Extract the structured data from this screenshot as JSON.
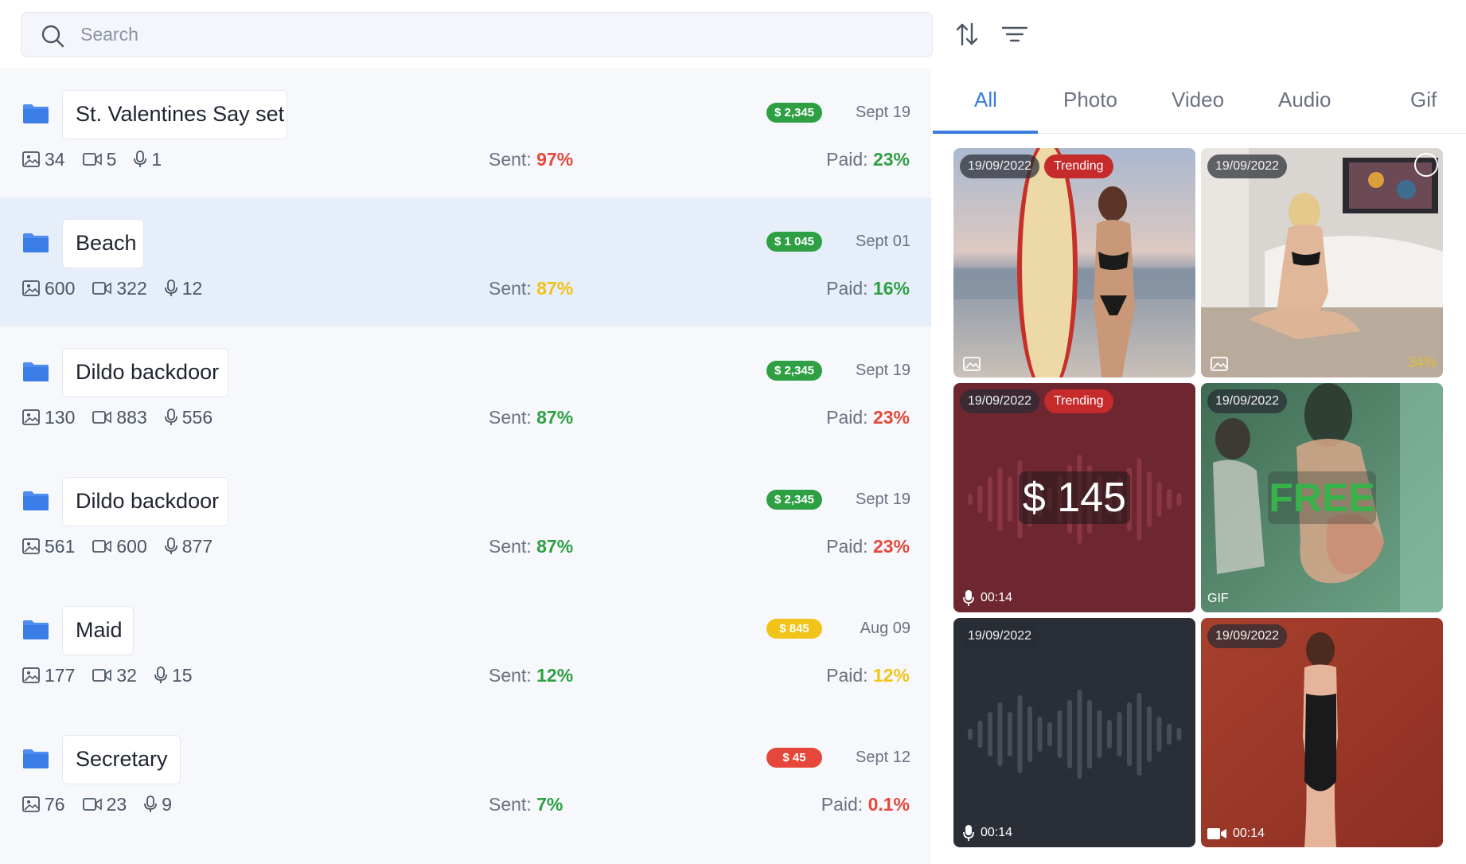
{
  "search": {
    "placeholder": "Search"
  },
  "toolbar": {
    "sort_icon": "sort-arrows-icon",
    "filter_icon": "filter-lines-icon"
  },
  "folders": [
    {
      "name": "St. Valentines Say set",
      "price": "$ 2,345",
      "price_color": "#2ea043",
      "date": "Sept 19",
      "photos": "34",
      "videos": "5",
      "audio": "1",
      "sent_label": "Sent:",
      "sent": "97%",
      "sent_color": "#e5483a",
      "paid_label": "Paid:",
      "paid": "23%",
      "paid_color": "#2ea043"
    },
    {
      "name": "Beach",
      "price": "$ 1 045",
      "price_color": "#2ea043",
      "date": "Sept 01",
      "photos": "600",
      "videos": "322",
      "audio": "12",
      "sent_label": "Sent:",
      "sent": "87%",
      "sent_color": "#f2c318",
      "paid_label": "Paid:",
      "paid": "16%",
      "paid_color": "#2ea043"
    },
    {
      "name": "Dildo backdoor",
      "price": "$ 2,345",
      "price_color": "#2ea043",
      "date": "Sept 19",
      "photos": "130",
      "videos": "883",
      "audio": "556",
      "sent_label": "Sent:",
      "sent": "87%",
      "sent_color": "#2ea043",
      "paid_label": "Paid:",
      "paid": "23%",
      "paid_color": "#e5483a"
    },
    {
      "name": "Dildo backdoor",
      "price": "$ 2,345",
      "price_color": "#2ea043",
      "date": "Sept 19",
      "photos": "561",
      "videos": "600",
      "audio": "877",
      "sent_label": "Sent:",
      "sent": "87%",
      "sent_color": "#2ea043",
      "paid_label": "Paid:",
      "paid": "23%",
      "paid_color": "#e5483a"
    },
    {
      "name": "Maid",
      "price": "$ 845",
      "price_color": "#f2c318",
      "date": "Aug 09",
      "photos": "177",
      "videos": "32",
      "audio": "15",
      "sent_label": "Sent:",
      "sent": "12%",
      "sent_color": "#2ea043",
      "paid_label": "Paid:",
      "paid": "12%",
      "paid_color": "#f2c318"
    },
    {
      "name": "Secretary",
      "price": "$ 45",
      "price_color": "#e5483a",
      "date": "Sept 12",
      "photos": "76",
      "videos": "23",
      "audio": "9",
      "sent_label": "Sent:",
      "sent": "7%",
      "sent_color": "#2ea043",
      "paid_label": "Paid:",
      "paid": "0.1%",
      "paid_color": "#e5483a"
    }
  ],
  "tabs": [
    "All",
    "Photo",
    "Video",
    "Audio",
    "Gif"
  ],
  "active_tab": "All",
  "media": [
    {
      "date": "19/09/2022",
      "trending": "Trending",
      "type": "photo-icon"
    },
    {
      "date": "19/09/2022",
      "type": "photo-icon",
      "overlay_pct": "34%"
    },
    {
      "date": "19/09/2022",
      "trending": "Trending",
      "price": "$ 145",
      "duration": "00:14",
      "type": "microphone-icon"
    },
    {
      "date": "19/09/2022",
      "free": "FREE",
      "gif": "GIF"
    },
    {
      "date": "19/09/2022",
      "duration": "00:14",
      "type": "microphone-icon"
    },
    {
      "date": "19/09/2022",
      "duration": "00:14",
      "type": "video-camera-icon"
    }
  ]
}
